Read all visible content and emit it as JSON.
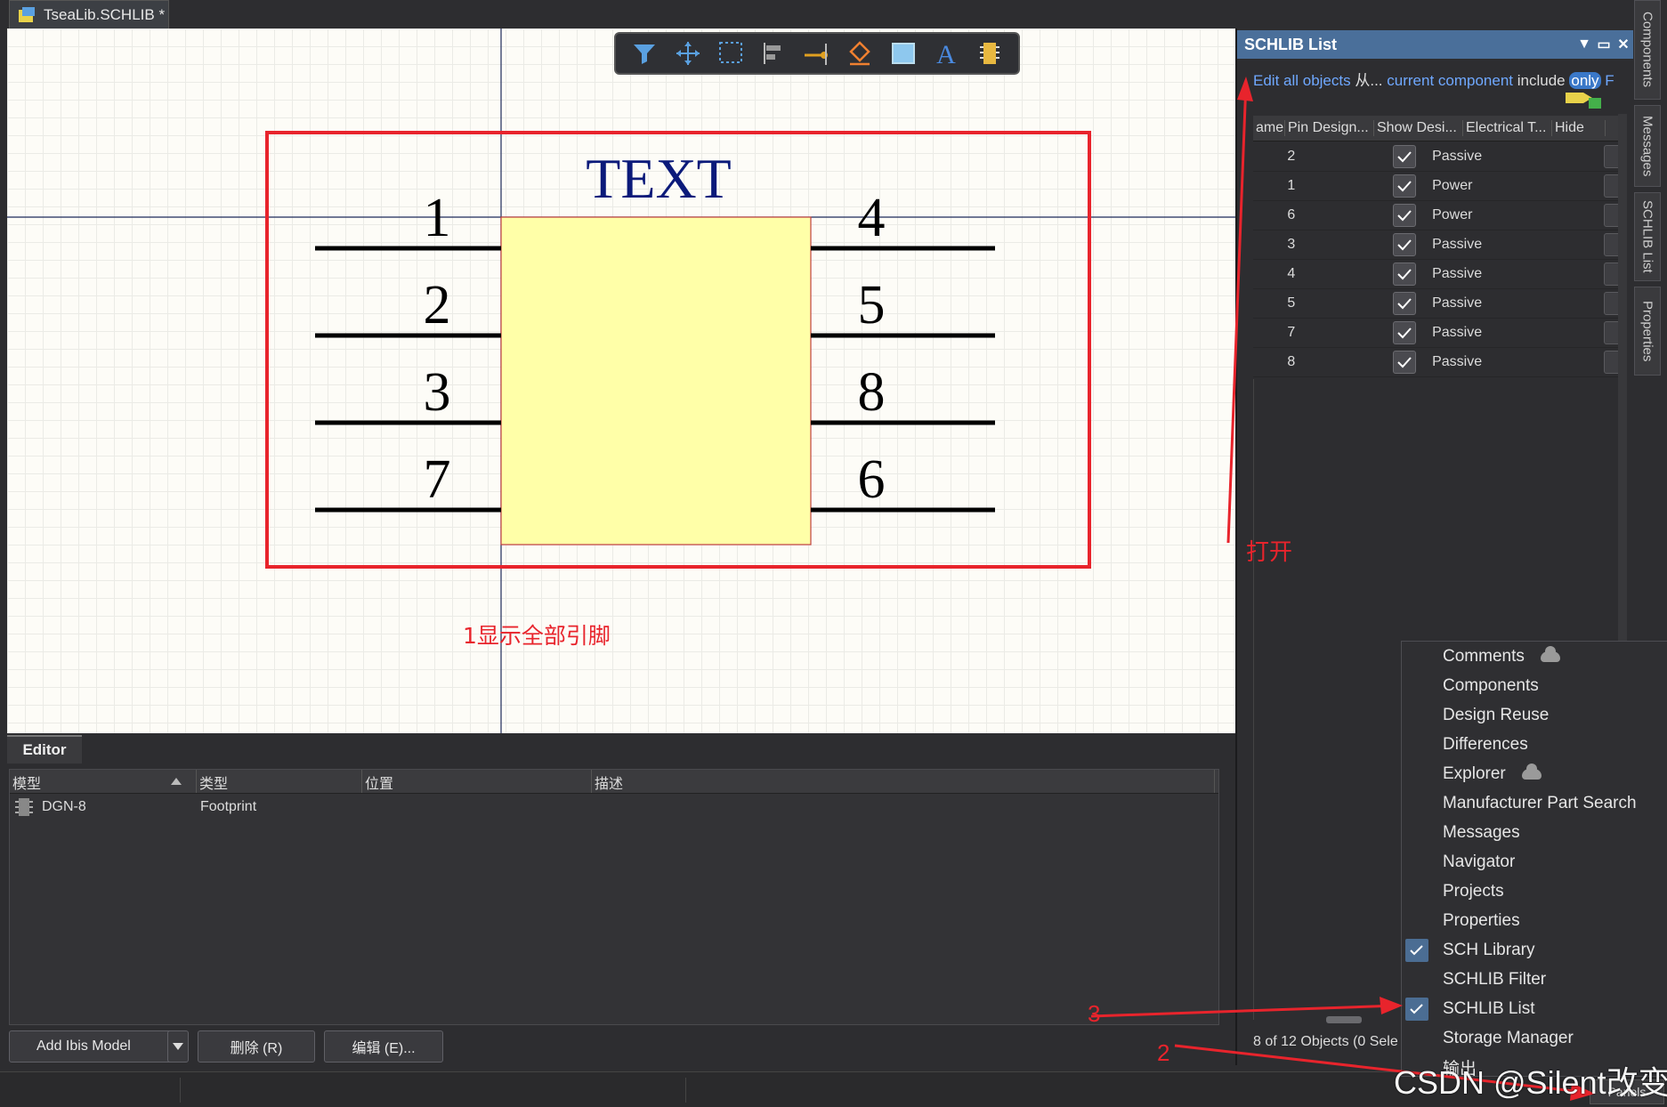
{
  "document_tab": {
    "title": "TseaLib.SCHLIB *"
  },
  "canvas": {
    "component_text": "TEXT",
    "left_pins": [
      "1",
      "2",
      "3",
      "7"
    ],
    "right_pins": [
      "4",
      "5",
      "8",
      "6"
    ],
    "note": "1显示全部引脚"
  },
  "toolbar": {
    "icons": [
      "filter-icon",
      "move-icon",
      "select-rect-icon",
      "align-icon",
      "place-pin-icon",
      "draw-shape-icon",
      "rectangle-icon",
      "text-icon",
      "part-icon"
    ]
  },
  "schlib_list": {
    "title": "SCHLIB List",
    "options": {
      "edit": "Edit all objects",
      "from": "从...",
      "scope": "current component",
      "include": "include",
      "only": "only",
      "trail": "F"
    },
    "columns": [
      "ame",
      "Pin Design...",
      "Show Desi...",
      "Electrical T...",
      "Hide"
    ],
    "rows": [
      {
        "designator": "2",
        "show": true,
        "electrical": "Passive"
      },
      {
        "designator": "1",
        "show": true,
        "electrical": "Power"
      },
      {
        "designator": "6",
        "show": true,
        "electrical": "Power"
      },
      {
        "designator": "3",
        "show": true,
        "electrical": "Passive"
      },
      {
        "designator": "4",
        "show": true,
        "electrical": "Passive"
      },
      {
        "designator": "5",
        "show": true,
        "electrical": "Passive"
      },
      {
        "designator": "7",
        "show": true,
        "electrical": "Passive"
      },
      {
        "designator": "8",
        "show": true,
        "electrical": "Passive"
      }
    ],
    "status": "8 of 12 Objects (0 Sele"
  },
  "side_tabs": [
    "Components",
    "Messages",
    "SCHLIB List",
    "Properties"
  ],
  "editor": {
    "tab": "Editor",
    "columns": [
      "模型",
      "类型",
      "位置",
      "描述"
    ],
    "rows": [
      {
        "model": "DGN-8",
        "type": "Footprint"
      }
    ],
    "buttons": {
      "add": "Add Ibis Model",
      "delete": "删除 (R)",
      "edit": "编辑 (E)..."
    }
  },
  "panels_menu": {
    "items": [
      {
        "label": "Comments",
        "checked": false,
        "cloud": true
      },
      {
        "label": "Components",
        "checked": false,
        "cloud": false
      },
      {
        "label": "Design Reuse",
        "checked": false,
        "cloud": false
      },
      {
        "label": "Differences",
        "checked": false,
        "cloud": false
      },
      {
        "label": "Explorer",
        "checked": false,
        "cloud": true
      },
      {
        "label": "Manufacturer Part Search",
        "checked": false,
        "cloud": false
      },
      {
        "label": "Messages",
        "checked": false,
        "cloud": false
      },
      {
        "label": "Navigator",
        "checked": false,
        "cloud": false
      },
      {
        "label": "Projects",
        "checked": false,
        "cloud": false
      },
      {
        "label": "Properties",
        "checked": false,
        "cloud": false
      },
      {
        "label": "SCH Library",
        "checked": true,
        "cloud": false
      },
      {
        "label": "SCHLIB Filter",
        "checked": false,
        "cloud": false
      },
      {
        "label": "SCHLIB List",
        "checked": true,
        "cloud": false
      },
      {
        "label": "Storage Manager",
        "checked": false,
        "cloud": false
      },
      {
        "label": "输出",
        "checked": false,
        "cloud": false
      }
    ]
  },
  "annotations": {
    "open": "打开",
    "step2": "2",
    "step3": "3"
  },
  "watermark": "CSDN @Silent改变",
  "panels_button": "Panels",
  "colors": {
    "accent": "#4a6f9a",
    "annotation": "#e8242c",
    "body_fill": "#ffffa8",
    "pin": "#000000",
    "component_text": "#0b1a7a"
  }
}
